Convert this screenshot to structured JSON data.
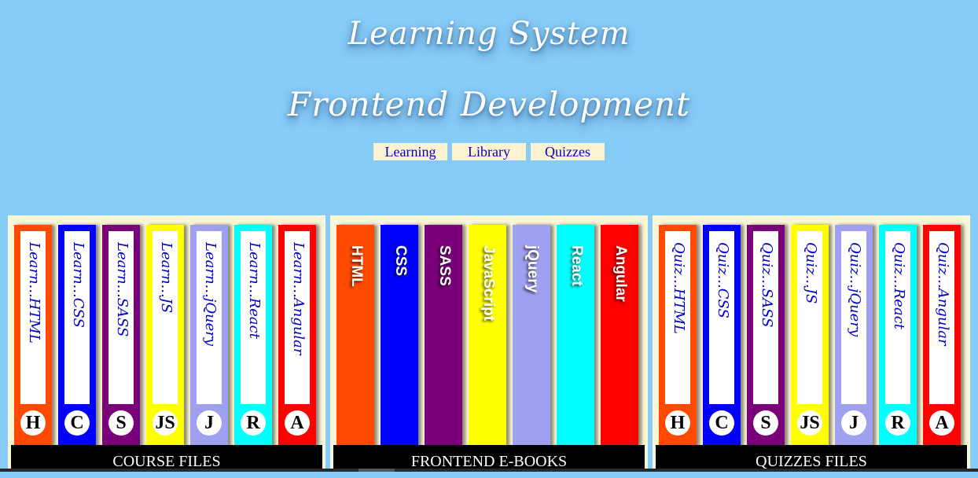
{
  "header": {
    "title_line1": "Learning System",
    "title_line2": "Frontend Development"
  },
  "nav": {
    "items": [
      "Learning",
      "Library",
      "Quizzes"
    ]
  },
  "colors": {
    "background": "#87cbf7",
    "panel": "#fbf6d6",
    "nav_bg": "#fdf3d0",
    "link": "#0000cc",
    "books": [
      "#ff4a00",
      "#0000ff",
      "#7a007a",
      "#ffff00",
      "#a0a0f0",
      "#00ffff",
      "#ff0000"
    ]
  },
  "courses": {
    "label": "COURSE FILES",
    "books": [
      {
        "spine": "Learn...HTML",
        "badge": "H"
      },
      {
        "spine": "Learn...CSS",
        "badge": "C"
      },
      {
        "spine": "Learn...SASS",
        "badge": "S"
      },
      {
        "spine": "Learn...JS",
        "badge": "JS"
      },
      {
        "spine": "Learn...jQuery",
        "badge": "J"
      },
      {
        "spine": "Learn...React",
        "badge": "R"
      },
      {
        "spine": "Learn...Angular",
        "badge": "A"
      }
    ]
  },
  "ebooks": {
    "label": "FRONTEND E-BOOKS",
    "books": [
      {
        "spine": "HTML"
      },
      {
        "spine": "CSS"
      },
      {
        "spine": "SASS"
      },
      {
        "spine": "JavaScript"
      },
      {
        "spine": "jQuery"
      },
      {
        "spine": "React"
      },
      {
        "spine": "Angular"
      }
    ]
  },
  "quizzes": {
    "label": "QUIZZES FILES",
    "books": [
      {
        "spine": "Quiz...HTML",
        "badge": "H"
      },
      {
        "spine": "Quiz...CSS",
        "badge": "C"
      },
      {
        "spine": "Quiz...SASS",
        "badge": "S"
      },
      {
        "spine": "Quiz...JS",
        "badge": "JS"
      },
      {
        "spine": "Quiz...jQuery",
        "badge": "J"
      },
      {
        "spine": "Quiz...React",
        "badge": "R"
      },
      {
        "spine": "Quiz...Angular",
        "badge": "A"
      }
    ]
  }
}
